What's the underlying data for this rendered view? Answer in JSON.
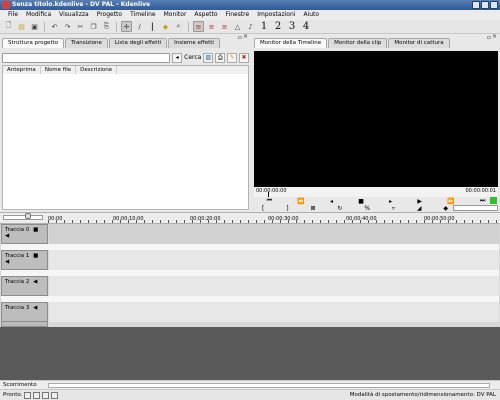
{
  "window": {
    "title": "Senza titolo.kdenlive - DV PAL - Kdenlive"
  },
  "menu": [
    "File",
    "Modifica",
    "Visualizza",
    "Progetto",
    "Timeline",
    "Monitor",
    "Aspetto",
    "Finestre",
    "Impostazioni",
    "Aiuto"
  ],
  "toolbar": {
    "desktops": [
      "1",
      "2",
      "3",
      "4"
    ]
  },
  "project_panel": {
    "tabs": [
      "Struttura progetto",
      "Transizione",
      "Lista degli effetti",
      "Insieme effetti"
    ],
    "search_label": "Cerca",
    "columns": [
      "Anteprima",
      "Nome file",
      "Descrizione"
    ]
  },
  "monitor_panel": {
    "tabs": [
      "Monitor della Timeline",
      "Monitor della clip",
      "Monitor di cattura"
    ],
    "time_start": "00:00:00:00",
    "time_end": "00:00:00:01"
  },
  "timeline": {
    "ruler_labels": [
      "00:00",
      "00:00:10:00",
      "00:00:20:00",
      "00:00:30:00",
      "00:00:40:00",
      "00:00:50:00"
    ],
    "tracks": [
      "Traccia 0",
      "Traccia 1",
      "Traccia 2",
      "Traccia 3"
    ]
  },
  "scroll": {
    "label": "Scorrimento"
  },
  "status": {
    "ready": "Pronto.",
    "message": "Modalità di spostamento/ridimensionamento: DV PAL"
  },
  "colors": {
    "titlebar": "#2d5a99",
    "monitor_bg": "#000000",
    "green_indicator": "#2ec02e"
  }
}
